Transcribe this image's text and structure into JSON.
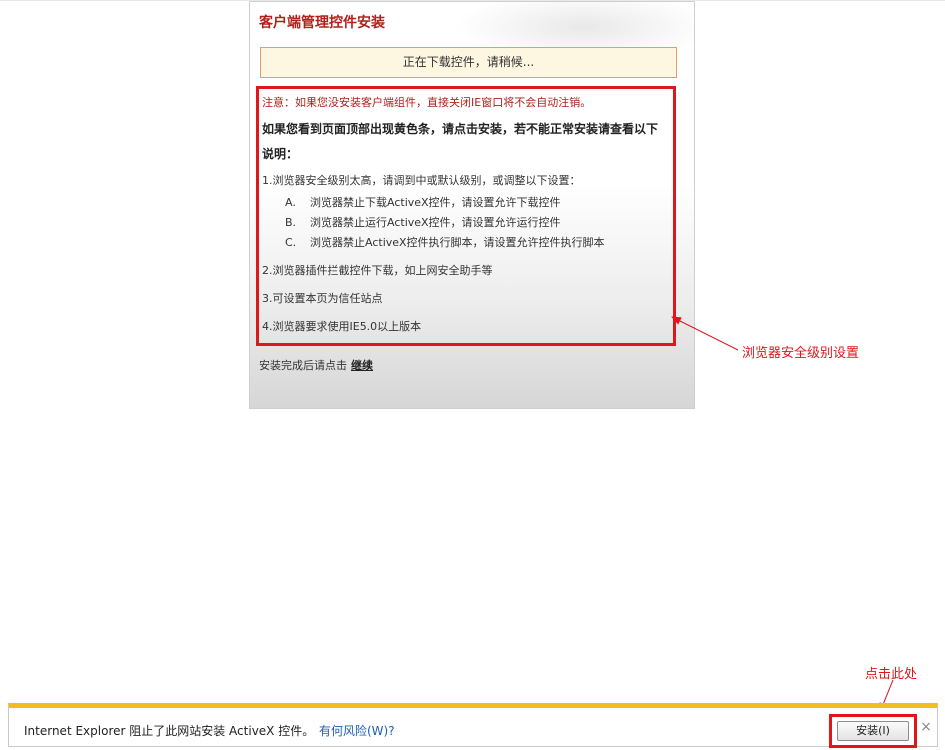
{
  "panel": {
    "title": "客户端管理控件安装",
    "status": "正在下载控件，请稍候...",
    "note": "注意：如果您没安装客户端组件，直接关闭IE窗口将不会自动注销。",
    "instruction": "如果您看到页面顶部出现黄色条，请点击安装，若不能正常安装请查看以下说明：",
    "items": [
      "1.浏览器安全级别太高，请调到中或默认级别，或调整以下设置：",
      "2.浏览器插件拦截控件下载，如上网安全助手等",
      "3.可设置本页为信任站点",
      "4.浏览器要求使用IE5.0以上版本"
    ],
    "sub_items": [
      {
        "letter": "A.",
        "text": "浏览器禁止下载ActiveX控件，请设置允许下载控件"
      },
      {
        "letter": "B.",
        "text": "浏览器禁止运行ActiveX控件，请设置允许运行控件"
      },
      {
        "letter": "C.",
        "text": "浏览器禁止ActiveX控件执行脚本，请设置允许控件执行脚本"
      }
    ],
    "continue_prefix": "安装完成后请点击",
    "continue_link": "继续"
  },
  "annotations": {
    "security_label": "浏览器安全级别设置",
    "click_here_label": "点击此处",
    "color": "#e0161d"
  },
  "ie_bar": {
    "message": "Internet Explorer 阻止了此网站安装 ActiveX 控件。",
    "risk_link": "有何风险(W)?",
    "install_button": "安装(I)",
    "close_glyph": "×",
    "accent_color": "#f3bd1f"
  }
}
